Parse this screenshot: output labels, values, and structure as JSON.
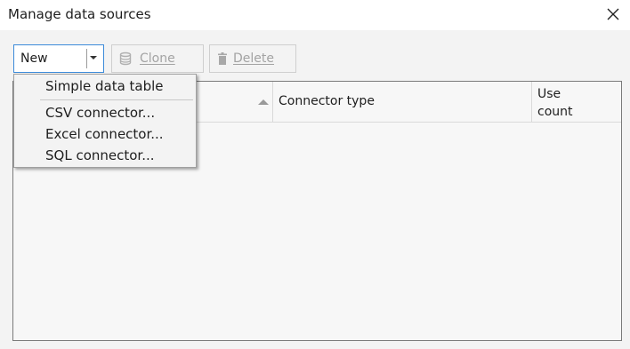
{
  "window": {
    "title": "Manage data sources",
    "close_icon": "close-icon"
  },
  "toolbar": {
    "new_label": "New",
    "clone_label": "Clone",
    "clone_icon": "database-icon",
    "delete_label": "Delete",
    "delete_icon": "trash-icon"
  },
  "grid": {
    "columns": [
      {
        "label": ""
      },
      {
        "label": "Connector type"
      },
      {
        "label": "Use count"
      }
    ],
    "sort": "ascending",
    "rows": []
  },
  "new_menu": {
    "items": [
      {
        "label": "Simple data table"
      },
      {
        "label": "CSV connector..."
      },
      {
        "label": "Excel connector..."
      },
      {
        "label": "SQL connector..."
      }
    ]
  },
  "colors": {
    "accent": "#3b8ad9",
    "disabled_text": "#a3a3a3",
    "background": "#f3f3f3"
  }
}
